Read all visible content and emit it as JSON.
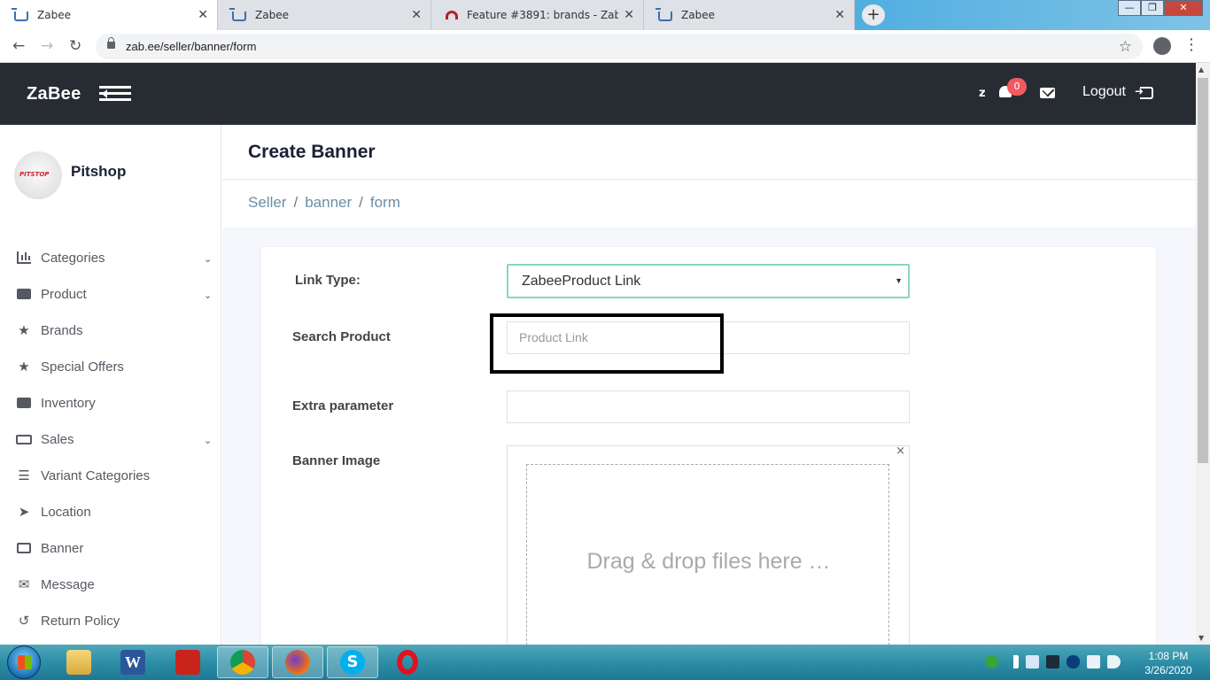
{
  "browser": {
    "tabs": [
      {
        "title": "Zabee",
        "active": true
      },
      {
        "title": "Zabee",
        "active": false
      },
      {
        "title": "Feature #3891: brands - Zabee -",
        "active": false
      },
      {
        "title": "Zabee",
        "active": false
      }
    ],
    "url": "zab.ee/seller/banner/form",
    "new_tab": "+",
    "close_glyph": "✕"
  },
  "header": {
    "logo": "ZaBee",
    "user_initial": "z",
    "notification_count": "0",
    "logout_label": "Logout"
  },
  "sidebar": {
    "shop_name": "Pitshop",
    "items": [
      {
        "label": "Categories",
        "icon": "bar-chart-icon",
        "expandable": true
      },
      {
        "label": "Product",
        "icon": "briefcase-icon",
        "expandable": true
      },
      {
        "label": "Brands",
        "icon": "star-icon",
        "expandable": false
      },
      {
        "label": "Special Offers",
        "icon": "star-icon",
        "expandable": false
      },
      {
        "label": "Inventory",
        "icon": "briefcase-icon",
        "expandable": false
      },
      {
        "label": "Sales",
        "icon": "money-icon",
        "expandable": true
      },
      {
        "label": "Variant Categories",
        "icon": "list-icon",
        "expandable": false
      },
      {
        "label": "Location",
        "icon": "location-arrow-icon",
        "expandable": false
      },
      {
        "label": "Banner",
        "icon": "image-icon",
        "expandable": false
      },
      {
        "label": "Message",
        "icon": "envelope-icon",
        "expandable": false
      },
      {
        "label": "Return Policy",
        "icon": "undo-icon",
        "expandable": false
      }
    ]
  },
  "page": {
    "title": "Create Banner",
    "breadcrumb": [
      "Seller",
      "banner",
      "form"
    ],
    "breadcrumb_sep": "/"
  },
  "form": {
    "link_type_label": "Link Type:",
    "link_type_value": "ZabeeProduct Link",
    "search_product_label": "Search Product",
    "search_product_placeholder": "Product Link",
    "extra_parameter_label": "Extra parameter",
    "extra_parameter_value": "",
    "banner_image_label": "Banner Image",
    "dropzone_message": "Drag & drop files here …",
    "dropzone_close": "×"
  },
  "taskbar": {
    "time": "1:08 PM",
    "date": "3/26/2020"
  },
  "colors": {
    "header_bg": "#272c33",
    "badge": "#f25961",
    "breadcrumb": "#6a8fa6",
    "select_border": "#8ad4c4"
  }
}
